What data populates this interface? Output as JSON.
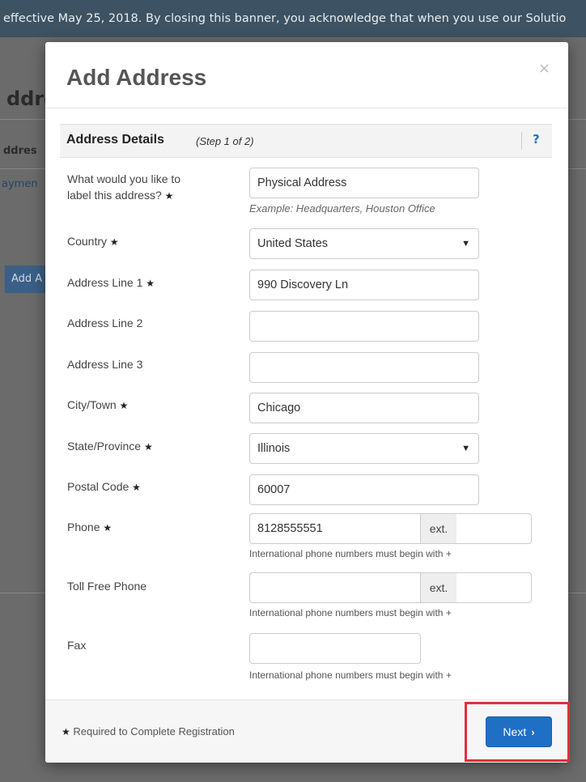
{
  "background": {
    "banner_text": "effective May 25, 2018. By closing this banner, you acknowledge that when you use our Solutio",
    "page_title": "ddre",
    "section_label": "ddres",
    "link_text": "aymen",
    "button_text": "Add A"
  },
  "modal": {
    "title": "Add Address",
    "close_icon": "×",
    "section": {
      "title": "Address Details",
      "step": "(Step 1 of 2)",
      "help": "?"
    },
    "required_star": "★",
    "fields": {
      "label": {
        "label_line1": "What would you like to",
        "label_line2": "label this address?",
        "value": "Physical Address",
        "hint": "Example: Headquarters, Houston Office"
      },
      "country": {
        "label": "Country",
        "value": "United States"
      },
      "address1": {
        "label": "Address Line 1",
        "value": "990 Discovery Ln"
      },
      "address2": {
        "label": "Address Line 2",
        "value": ""
      },
      "address3": {
        "label": "Address Line 3",
        "value": ""
      },
      "city": {
        "label": "City/Town",
        "value": "Chicago"
      },
      "state": {
        "label": "State/Province",
        "value": "Illinois"
      },
      "postal": {
        "label": "Postal Code",
        "value": "60007"
      },
      "phone": {
        "label": "Phone",
        "value": "8128555551",
        "ext_label": "ext.",
        "ext_value": "",
        "hint": "International phone numbers must begin with +"
      },
      "tollfree": {
        "label": "Toll Free Phone",
        "value": "",
        "ext_label": "ext.",
        "ext_value": "",
        "hint": "International phone numbers must begin with +"
      },
      "fax": {
        "label": "Fax",
        "value": "",
        "hint": "International phone numbers must begin with +"
      }
    },
    "footer": {
      "required_note": "Required to Complete Registration",
      "next_label": "Next",
      "next_icon": "›"
    }
  },
  "select_arrow": "▼",
  "colors": {
    "primary": "#1f6fc5",
    "highlight": "#e0303c",
    "help": "#1e73be"
  }
}
